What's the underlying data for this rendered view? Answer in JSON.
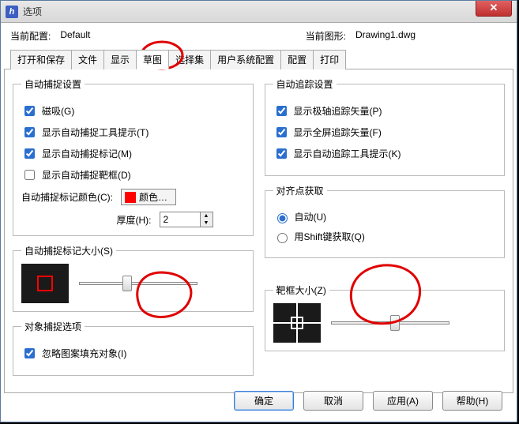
{
  "window": {
    "title": "选项"
  },
  "config": {
    "current_label": "当前配置:",
    "current_value": "Default",
    "drawing_label": "当前图形:",
    "drawing_value": "Drawing1.dwg"
  },
  "tabs": {
    "open_save": "打开和保存",
    "file": "文件",
    "display": "显示",
    "sketch": "草图",
    "select_set": "选择集",
    "user_sys": "用户系统配置",
    "config": "配置",
    "print": "打印"
  },
  "autosnap": {
    "legend": "自动捕捉设置",
    "magnet": "磁吸(G)",
    "tooltip": "显示自动捕捉工具提示(T)",
    "marker": "显示自动捕捉标记(M)",
    "aperture": "显示自动捕捉靶框(D)",
    "color_label": "自动捕捉标记颜色(C):",
    "color_btn": "颜色…",
    "thickness_label": "厚度(H):",
    "thickness_value": "2"
  },
  "autotrack": {
    "legend": "自动追踪设置",
    "polar": "显示极轴追踪矢量(P)",
    "fullscreen": "显示全屏追踪矢量(F)",
    "track_tip": "显示自动追踪工具提示(K)"
  },
  "align": {
    "legend": "对齐点获取",
    "auto": "自动(U)",
    "shift": "用Shift键获取(Q)"
  },
  "marker_size": {
    "legend": "自动捕捉标记大小(S)"
  },
  "target_size": {
    "legend": "靶框大小(Z)"
  },
  "obj_snap": {
    "legend": "对象捕捉选项",
    "ignore_hatch": "忽略图案填充对象(I)"
  },
  "buttons": {
    "ok": "确定",
    "cancel": "取消",
    "apply": "应用(A)",
    "help": "帮助(H)"
  }
}
